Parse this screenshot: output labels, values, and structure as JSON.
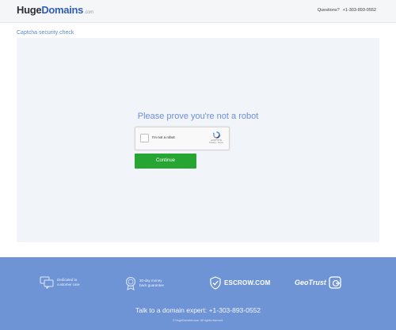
{
  "header": {
    "logo_huge": "Huge",
    "logo_domains": "Domains",
    "logo_tld": ".com",
    "questions_label": "Questions?",
    "phone": "+1-303-893-0552"
  },
  "breadcrumb": "Captcha security check",
  "captcha": {
    "heading": "Please prove you're not a robot",
    "checkbox_label": "I'm not a robot",
    "recaptcha_brand": "reCAPTCHA",
    "recaptcha_terms": "Privacy - Terms",
    "continue_label": "Continue"
  },
  "footer": {
    "badge1": [
      "Dedicated to",
      "customer care"
    ],
    "badge2": [
      "30-day money",
      "back guarantee"
    ],
    "escrow_label": "ESCROW.COM",
    "geotrust_label": "GeoTrust",
    "talk": "Talk to a domain expert: +1-303-893-0552",
    "copyright": "© HugeDomains.com. All rights reserved."
  },
  "colors": {
    "brand_blue": "#2f5db8",
    "link_blue": "#5b86d6",
    "panel_bg": "#f1f4f8",
    "continue_green": "#27a533",
    "footer_blue": "#6f94d6"
  },
  "icons": [
    "chat-icon",
    "medal-icon",
    "shield-check-icon",
    "geotrust-seal-icon",
    "recaptcha-icon"
  ]
}
